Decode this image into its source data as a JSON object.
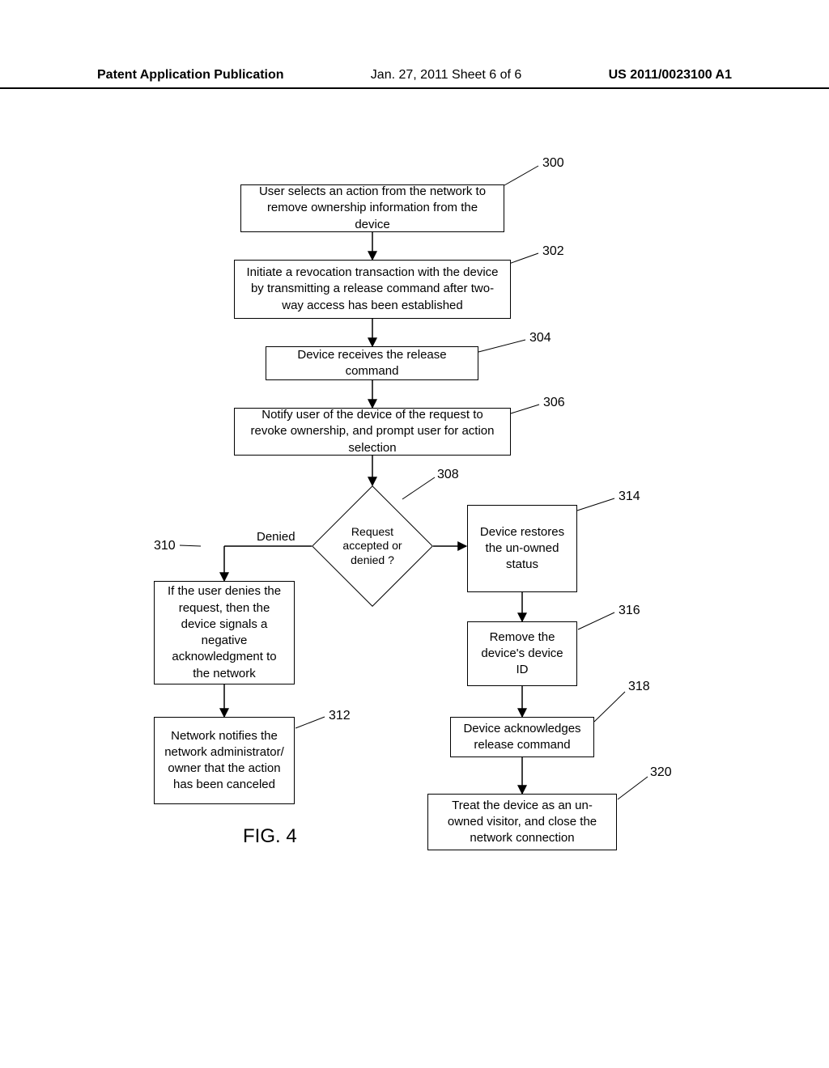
{
  "header": {
    "left": "Patent Application Publication",
    "center": "Jan. 27, 2011  Sheet 6 of 6",
    "right": "US 2011/0023100 A1"
  },
  "flowchart": {
    "figure_label": "FIG. 4",
    "refs": {
      "r300": "300",
      "r302": "302",
      "r304": "304",
      "r306": "306",
      "r308": "308",
      "r310": "310",
      "r312": "312",
      "r314": "314",
      "r316": "316",
      "r318": "318",
      "r320": "320"
    },
    "nodes": {
      "n300": "User selects an action from the network to remove ownership information from the device",
      "n302": "Initiate a revocation transaction with the device by transmitting a release command after two-way access has been established",
      "n304": "Device receives the release command",
      "n306": "Notify user of the device of the request to revoke ownership, and prompt user for action selection",
      "n308": "Request accepted or denied ?",
      "n310": "If the user denies the request, then the device signals a negative acknowledgment to the network",
      "n312": "Network notifies the network administrator/ owner that the action has been canceled",
      "n314": "Device restores the un-owned status",
      "n316": "Remove the device's device ID",
      "n318": "Device acknowledges release command",
      "n320": "Treat the device as an un-owned visitor, and close the network connection"
    },
    "edge_labels": {
      "denied": "Denied"
    }
  }
}
